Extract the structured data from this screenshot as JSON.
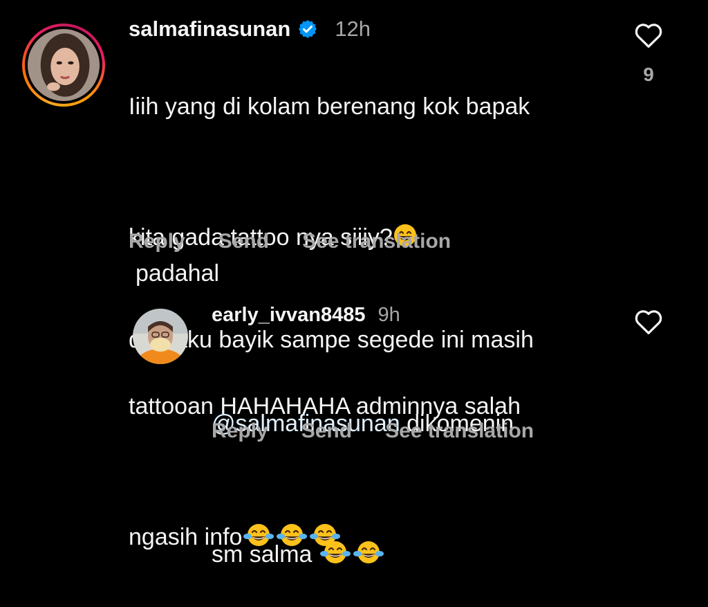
{
  "comments": [
    {
      "username": "salmafinasunan",
      "verified": true,
      "time": "12h",
      "lines": [
        "Iiih yang di kolam berenang kok bapak",
        "kita gada tattoo nya siiiy?",
        "padahal",
        "dari aku bayik sampe segede ini masih",
        "tattooan HAHAHAHA adminnya salah",
        "ngasih info"
      ],
      "likes": "9",
      "actions": {
        "reply": "Reply",
        "send": "Send",
        "translate": "See translation"
      }
    }
  ],
  "reply": {
    "username": "early_ivvan8485",
    "time": "9h",
    "mention": "@salmafinasunan",
    "text_line1_rest": " dikomenin",
    "text_line2": "sm salma",
    "actions": {
      "reply": "Reply",
      "send": "Send",
      "translate": "See translation"
    }
  },
  "colors": {
    "background": "#000000",
    "text": "#f5f5f5",
    "muted": "#a8a8a8",
    "verified": "#0095f6"
  },
  "icons": {
    "verified": "verified-badge-icon",
    "like": "heart-outline-icon",
    "emoji_grin": "grinning-emoji",
    "emoji_tears": "tears-of-joy-emoji"
  }
}
